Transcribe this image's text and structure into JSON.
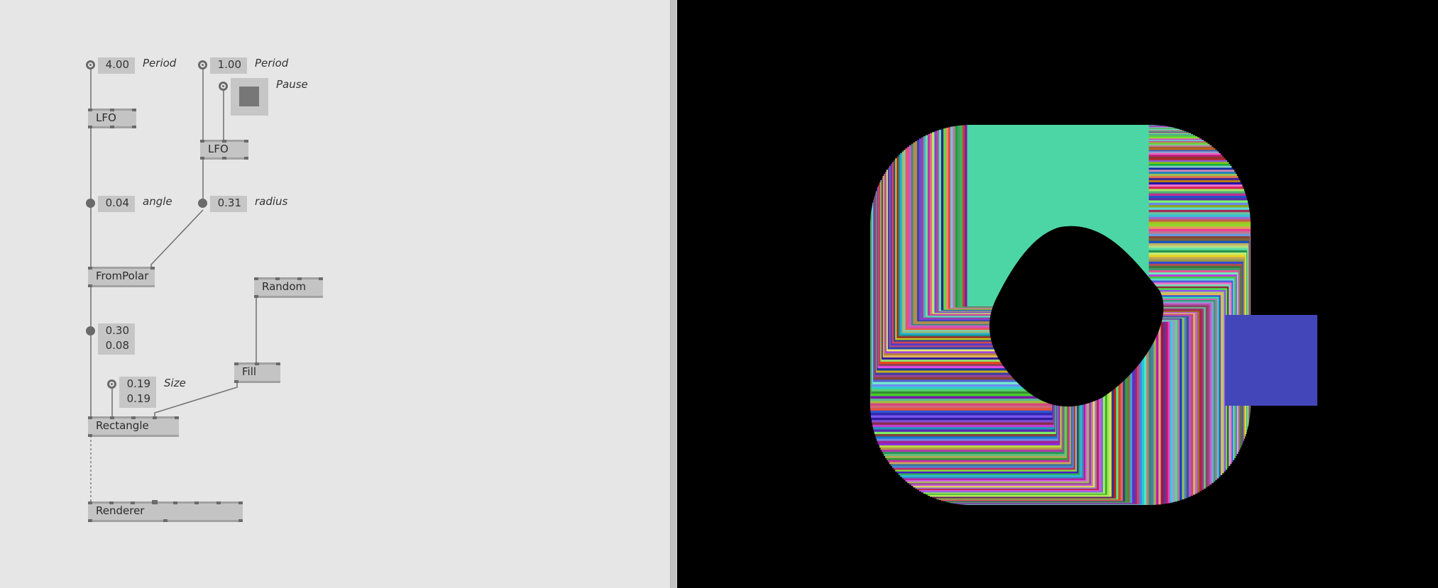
{
  "lfo1": {
    "period_value": "4.00",
    "period_label": "Period",
    "node_label": "LFO",
    "output_value": "0.04",
    "output_label": "angle"
  },
  "lfo2": {
    "period_value": "1.00",
    "period_label": "Period",
    "pause_label": "Pause",
    "node_label": "LFO",
    "output_value": "0.31",
    "output_label": "radius"
  },
  "frompolar": {
    "node_label": "FromPolar",
    "output_x": "0.30",
    "output_y": "0.08"
  },
  "random": {
    "node_label": "Random"
  },
  "fill": {
    "node_label": "Fill"
  },
  "size": {
    "value_x": "0.19",
    "value_y": "0.19",
    "label": "Size"
  },
  "rectangle": {
    "node_label": "Rectangle"
  },
  "renderer": {
    "node_label": "Renderer"
  },
  "colors": {
    "patch_bg": "#e6e6e6",
    "node_bg": "#c4c4c4",
    "render_bg": "#000000",
    "wire": "#6b6b6b"
  }
}
